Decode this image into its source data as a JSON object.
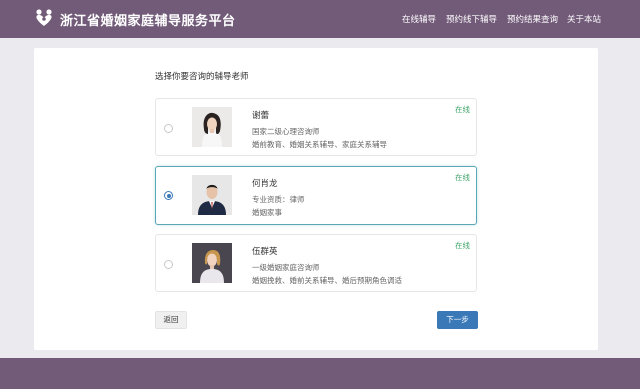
{
  "header": {
    "title": "浙江省婚姻家庭辅导服务平台",
    "logo_icon": "family-heart-icon",
    "nav": [
      {
        "label": "在线辅导"
      },
      {
        "label": "预约线下辅导"
      },
      {
        "label": "预约结果查询"
      },
      {
        "label": "关于本站"
      }
    ]
  },
  "main": {
    "prompt": "选择你要咨询的辅导老师",
    "counselors": [
      {
        "name": "谢蕾",
        "status": "在线",
        "line1": "国家二级心理咨询师",
        "line2": "婚前教育、婚姻关系辅导、家庭关系辅导",
        "selected": false
      },
      {
        "name": "何肖龙",
        "status": "在线",
        "line1": "专业资质：律师",
        "line2": "婚姻家事",
        "selected": true
      },
      {
        "name": "伍群英",
        "status": "在线",
        "line1": "一级婚姻家庭咨询师",
        "line2": "婚姻挽救、婚前关系辅导、婚后预期角色调适",
        "selected": false
      }
    ],
    "back_label": "返回",
    "next_label": "下一步"
  },
  "colors": {
    "header_bg": "#725a79",
    "accent": "#3a78b8",
    "online": "#3fa36a",
    "selected_border": "#5aa8b4"
  }
}
